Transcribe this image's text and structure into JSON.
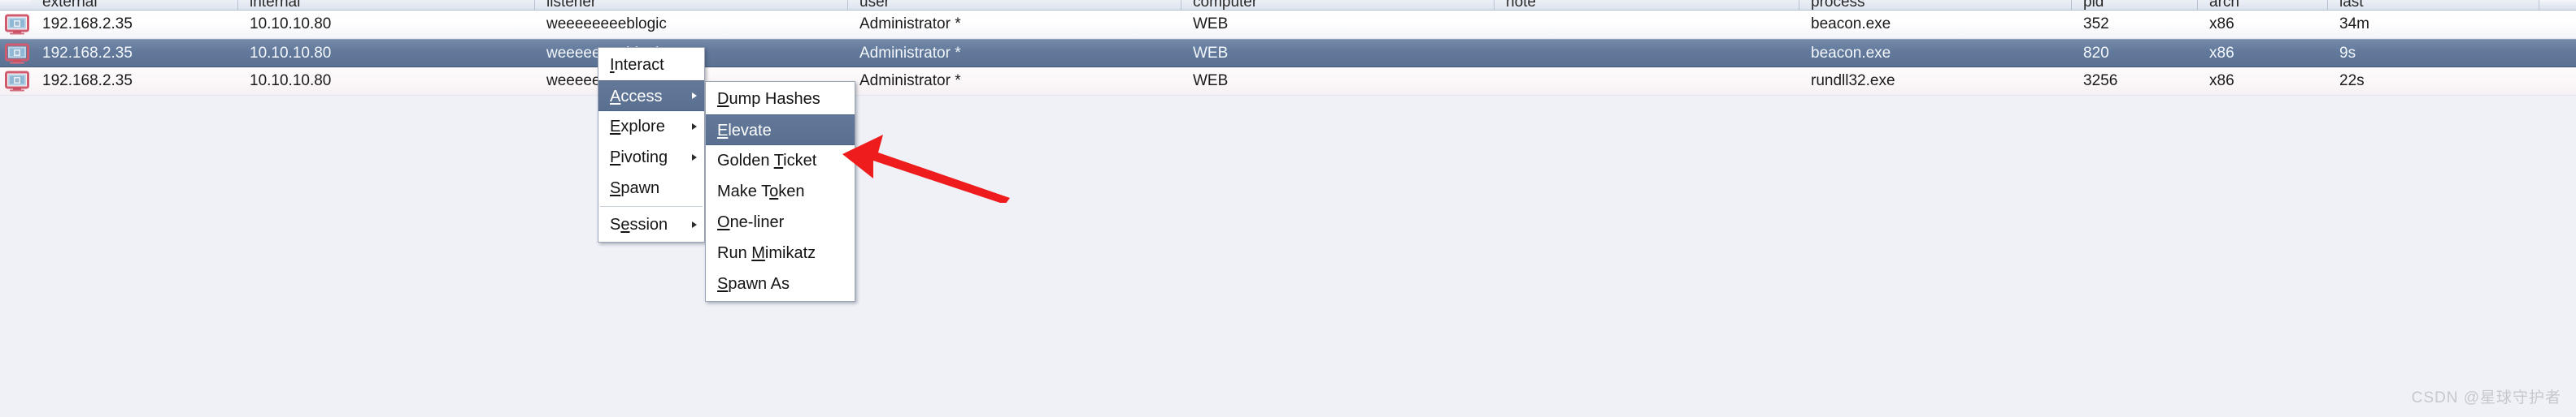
{
  "table": {
    "columns": [
      {
        "key": "external",
        "label": "external"
      },
      {
        "key": "internal",
        "label": "internal"
      },
      {
        "key": "listener",
        "label": "listener"
      },
      {
        "key": "user",
        "label": "user"
      },
      {
        "key": "computer",
        "label": "computer"
      },
      {
        "key": "note",
        "label": "note"
      },
      {
        "key": "process",
        "label": "process"
      },
      {
        "key": "pid",
        "label": "pid"
      },
      {
        "key": "arch",
        "label": "arch"
      },
      {
        "key": "last",
        "label": "last"
      }
    ],
    "rows": [
      {
        "icon": "beacon-host-icon",
        "external": "192.168.2.35",
        "internal": "10.10.10.80",
        "listener": "weeeeeeeeblogic",
        "user": "Administrator *",
        "computer": "WEB",
        "note": "",
        "process": "beacon.exe",
        "pid": "352",
        "arch": "x86",
        "last": "34m",
        "selected": false
      },
      {
        "icon": "beacon-host-icon",
        "external": "192.168.2.35",
        "internal": "10.10.10.80",
        "listener": "weeeeeeeeblogic",
        "user": "Administrator *",
        "computer": "WEB",
        "note": "",
        "process": "beacon.exe",
        "pid": "820",
        "arch": "x86",
        "last": "9s",
        "selected": true
      },
      {
        "icon": "beacon-host-icon",
        "external": "192.168.2.35",
        "internal": "10.10.10.80",
        "listener": "weeeeeeeeblogic",
        "user": "Administrator *",
        "computer": "WEB",
        "note": "",
        "process": "rundll32.exe",
        "pid": "3256",
        "arch": "x86",
        "last": "22s",
        "selected": false
      }
    ]
  },
  "context_menu": {
    "items": [
      {
        "label": "Interact",
        "mnemonic": "I",
        "submenu": false,
        "highlight": false,
        "separator_after": false
      },
      {
        "label": "Access",
        "mnemonic": "A",
        "submenu": true,
        "highlight": true,
        "separator_after": false
      },
      {
        "label": "Explore",
        "mnemonic": "E",
        "submenu": true,
        "highlight": false,
        "separator_after": false
      },
      {
        "label": "Pivoting",
        "mnemonic": "P",
        "submenu": true,
        "highlight": false,
        "separator_after": false
      },
      {
        "label": "Spawn",
        "mnemonic": "S",
        "submenu": false,
        "highlight": false,
        "separator_after": true
      },
      {
        "label": "Session",
        "mnemonic": "e",
        "submenu": true,
        "highlight": false,
        "separator_after": false
      }
    ]
  },
  "access_submenu": {
    "items": [
      {
        "label": "Dump Hashes",
        "mnemonic": "D",
        "highlight": false
      },
      {
        "label": "Elevate",
        "mnemonic": "E",
        "highlight": true
      },
      {
        "label": "Golden Ticket",
        "mnemonic": "T",
        "highlight": false
      },
      {
        "label": "Make Token",
        "mnemonic": "o",
        "highlight": false
      },
      {
        "label": "One-liner",
        "mnemonic": "O",
        "highlight": false
      },
      {
        "label": "Run Mimikatz",
        "mnemonic": "M",
        "highlight": false
      },
      {
        "label": "Spawn As",
        "mnemonic": "S",
        "highlight": false
      }
    ]
  },
  "annotation": {
    "arrow_color": "#ee1c1c",
    "arrow_target": "Elevate"
  },
  "watermark": {
    "text": "CSDN @星球守护者"
  },
  "colors": {
    "selection": "#5e7495",
    "background": "#eff1f7",
    "header": "#e4e9f2",
    "accent_red": "#ee1c1c"
  }
}
